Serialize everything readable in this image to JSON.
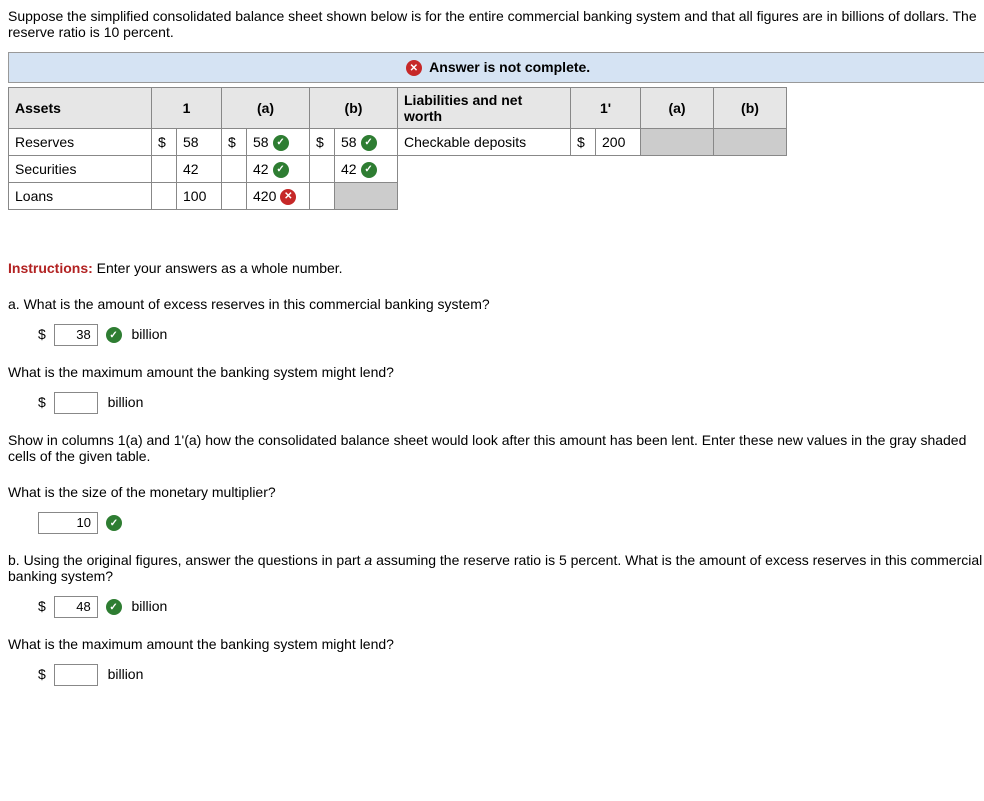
{
  "problem": "Suppose the simplified consolidated balance sheet shown below is for the entire commercial banking system and that all figures are in billions of dollars. The reserve ratio is 10 percent.",
  "banner": "Answer is not complete.",
  "table_headers": {
    "assets": "Assets",
    "one": "1",
    "a": "(a)",
    "b": "(b)",
    "liab": "Liabilities and net worth",
    "one_prime": "1'"
  },
  "assets": {
    "reserves": {
      "label": "Reserves",
      "d1": "$",
      "v1": "58",
      "d2": "$",
      "va": "58",
      "d3": "$",
      "vb": "58"
    },
    "securities": {
      "label": "Securities",
      "v1": "42",
      "va": "42",
      "vb": "42"
    },
    "loans": {
      "label": "Loans",
      "v1": "100",
      "va": "420"
    }
  },
  "liab": {
    "checkable": {
      "label": "Checkable deposits",
      "d1": "$",
      "v1": " 200"
    }
  },
  "instructions_label": "Instructions:",
  "instructions_text": " Enter your answers as a whole number.",
  "q_a": "a. What is the amount of excess reserves in this commercial banking system?",
  "ans_a": "38",
  "unit_billion": "billion",
  "q_a2": "What is the maximum amount the banking system might lend?",
  "ans_a2": "",
  "q_a3": "Show in columns 1(a) and 1'(a) how the consolidated balance sheet would look after this amount has been lent. Enter these new values in the gray shaded cells of the given table.",
  "q_a4": "What is the size of the monetary multiplier?",
  "ans_a4": "10",
  "q_b": "b. Using the original figures, answer the questions in part a assuming the reserve ratio is 5 percent. What is the amount of excess reserves in this commercial banking system?",
  "italic_a": "a",
  "q_b_pre": "b. Using the original figures, answer the questions in part ",
  "q_b_post": " assuming the reserve ratio is 5 percent. What is the amount of excess reserves in this commercial banking system?",
  "ans_b": "48",
  "q_b2": "What is the maximum amount the banking system might lend?",
  "ans_b2": "",
  "dollar": "$"
}
